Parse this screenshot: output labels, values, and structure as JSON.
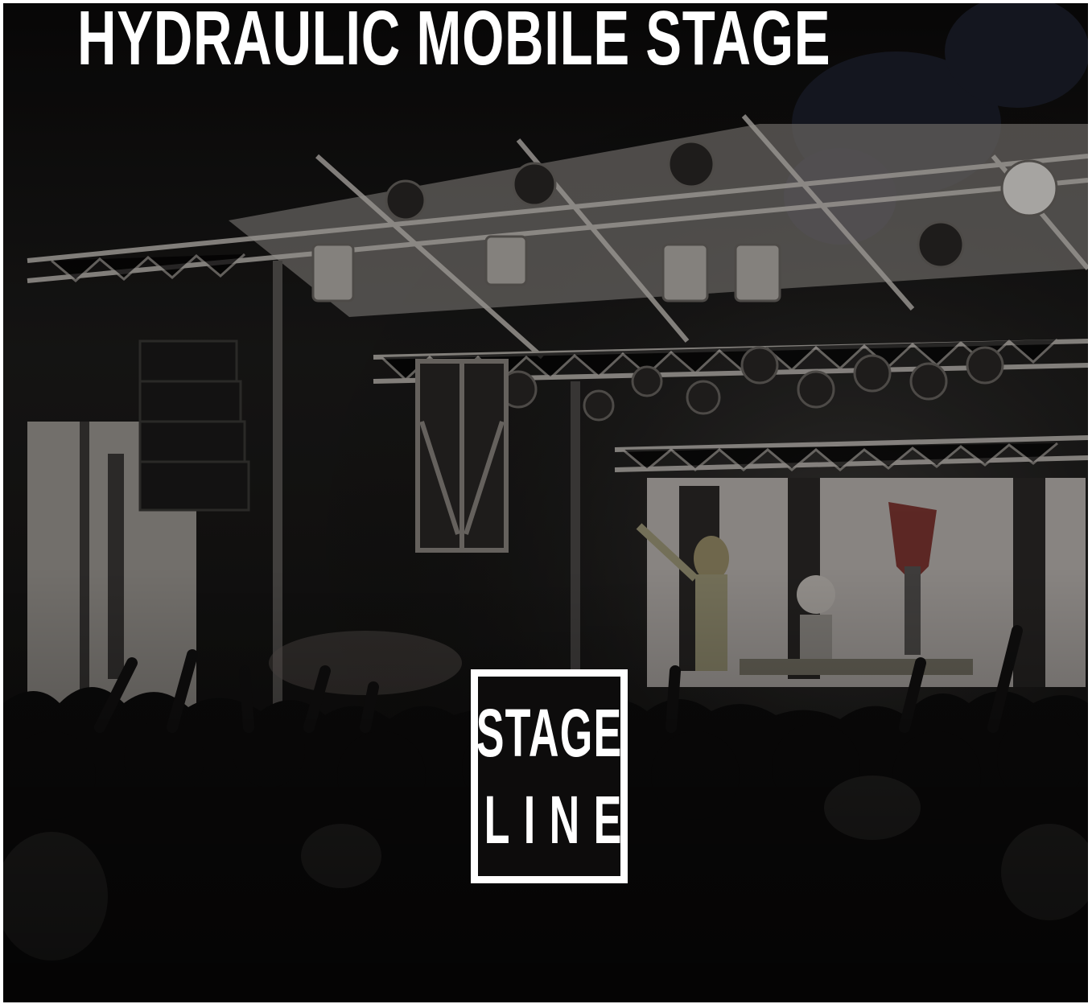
{
  "title": "HYDRAULIC MOBILE STAGE",
  "logo": {
    "line1": "STAGE",
    "line2": "LINE"
  },
  "colors": {
    "background": "#0d0c0c",
    "title_text": "#ffffff",
    "logo_frame": "#ffffff",
    "accent_screen": "#bdb7b3"
  },
  "scene": {
    "subject": "concert-photo-crowd-and-stage",
    "icons": [
      "stage-truss",
      "line-array-speaker",
      "moving-head-light",
      "led-screen",
      "crowd-silhouette"
    ]
  }
}
